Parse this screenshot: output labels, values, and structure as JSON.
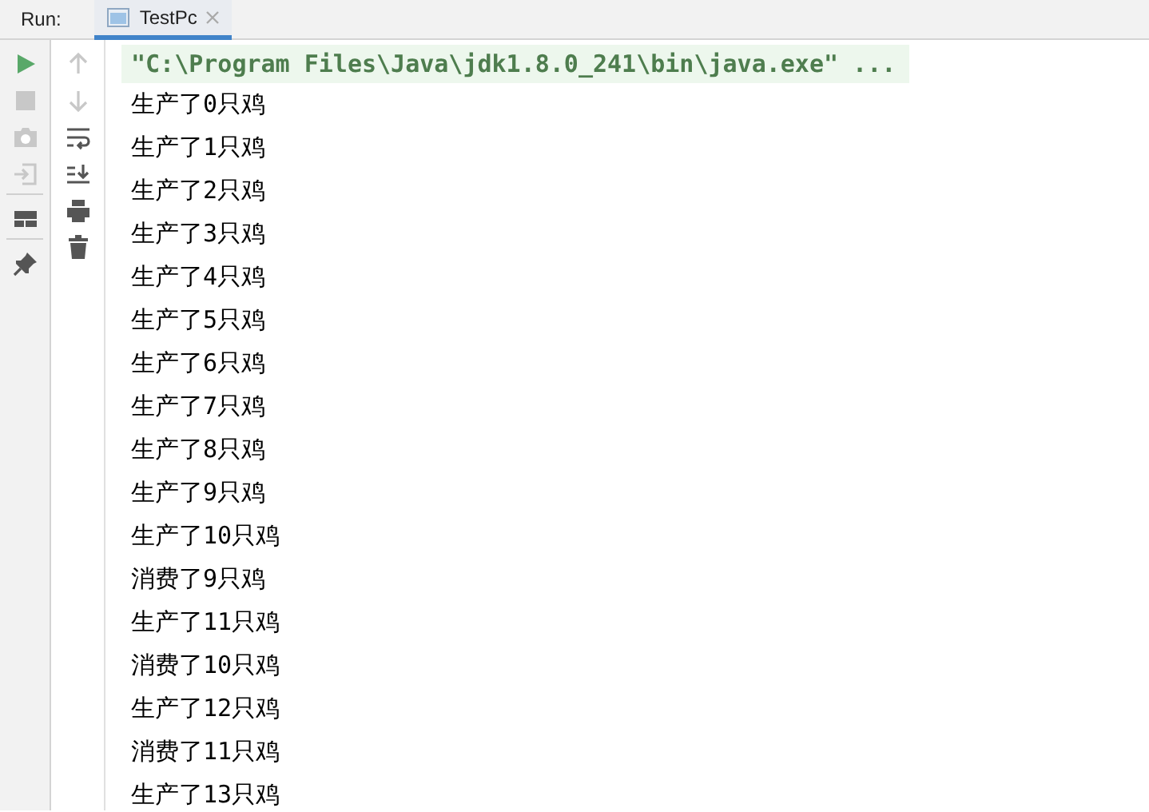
{
  "run_label": "Run:",
  "tabs": [
    {
      "label": "TestPc",
      "selected": true
    }
  ],
  "console": {
    "command": "\"C:\\Program Files\\Java\\jdk1.8.0_241\\bin\\java.exe\" ...",
    "lines": [
      "生产了0只鸡",
      "生产了1只鸡",
      "生产了2只鸡",
      "生产了3只鸡",
      "生产了4只鸡",
      "生产了5只鸡",
      "生产了6只鸡",
      "生产了7只鸡",
      "生产了8只鸡",
      "生产了9只鸡",
      "生产了10只鸡",
      "消费了9只鸡",
      "生产了11只鸡",
      "消费了10只鸡",
      "生产了12只鸡",
      "消费了11只鸡",
      "生产了13只鸡"
    ]
  }
}
